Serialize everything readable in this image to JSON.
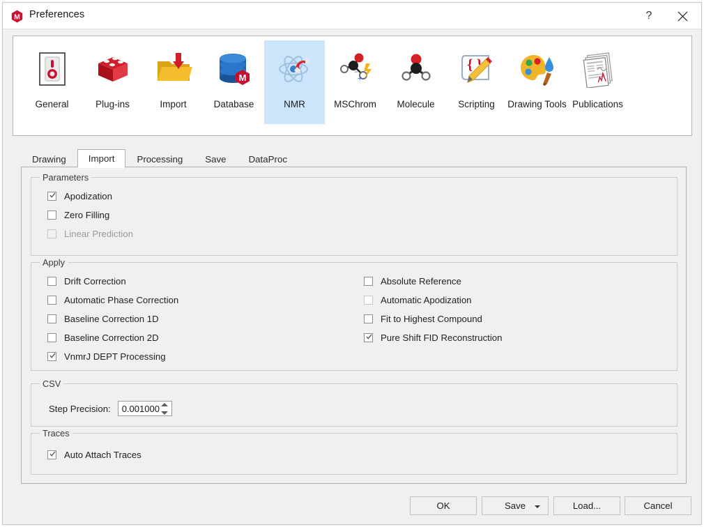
{
  "window": {
    "title": "Preferences",
    "logo_icon": "mnova-logo-icon",
    "help_label": "?",
    "close_label": "×"
  },
  "categories": [
    {
      "label": "General",
      "icon": "power-switch-icon",
      "selected": false
    },
    {
      "label": "Plug-ins",
      "icon": "lego-brick-icon",
      "selected": false
    },
    {
      "label": "Import",
      "icon": "folder-import-icon",
      "selected": false
    },
    {
      "label": "Database",
      "icon": "database-icon",
      "selected": false
    },
    {
      "label": "NMR",
      "icon": "nmr-atom-magnet-icon",
      "selected": true
    },
    {
      "label": "MSChrom",
      "icon": "ms-molecule-icon",
      "selected": false
    },
    {
      "label": "Molecule",
      "icon": "molecule-icon",
      "selected": false
    },
    {
      "label": "Scripting",
      "icon": "script-pencil-icon",
      "selected": false
    },
    {
      "label": "Drawing Tools",
      "icon": "palette-brush-icon",
      "selected": false
    },
    {
      "label": "Publications",
      "icon": "documents-icon",
      "selected": false
    }
  ],
  "tabs": [
    {
      "label": "Drawing",
      "active": false
    },
    {
      "label": "Import",
      "active": true
    },
    {
      "label": "Processing",
      "active": false
    },
    {
      "label": "Save",
      "active": false
    },
    {
      "label": "DataProc",
      "active": false
    }
  ],
  "groups": {
    "parameters": {
      "title": "Parameters",
      "items": [
        {
          "label": "Apodization",
          "checked": true,
          "enabled": true
        },
        {
          "label": "Zero Filling",
          "checked": false,
          "enabled": true
        },
        {
          "label": "Linear Prediction",
          "checked": false,
          "enabled": false
        }
      ]
    },
    "apply": {
      "title": "Apply",
      "left_items": [
        {
          "label": "Drift Correction",
          "checked": false,
          "enabled": true
        },
        {
          "label": "Automatic Phase Correction",
          "checked": false,
          "enabled": true
        },
        {
          "label": "Baseline Correction 1D",
          "checked": false,
          "enabled": true
        },
        {
          "label": "Baseline Correction 2D",
          "checked": false,
          "enabled": true
        },
        {
          "label": "VnmrJ DEPT Processing",
          "checked": true,
          "enabled": true
        }
      ],
      "right_items": [
        {
          "label": "Absolute Reference",
          "checked": false,
          "enabled": true
        },
        {
          "label": "Automatic Apodization",
          "checked": false,
          "enabled": true
        },
        {
          "label": "Fit to Highest Compound",
          "checked": false,
          "enabled": true
        },
        {
          "label": "Pure Shift FID Reconstruction",
          "checked": true,
          "enabled": true
        }
      ]
    },
    "csv": {
      "title": "CSV",
      "step_precision_label": "Step Precision:",
      "step_precision_value": "0.001000"
    },
    "traces": {
      "title": "Traces",
      "items": [
        {
          "label": "Auto Attach Traces",
          "checked": true,
          "enabled": true
        }
      ]
    }
  },
  "footer": {
    "ok": "OK",
    "save": "Save",
    "load": "Load...",
    "cancel": "Cancel"
  },
  "colors": {
    "accent_selected": "#cde5fa",
    "brand_red": "#c8102e",
    "window_bg": "#f0f0f0"
  }
}
